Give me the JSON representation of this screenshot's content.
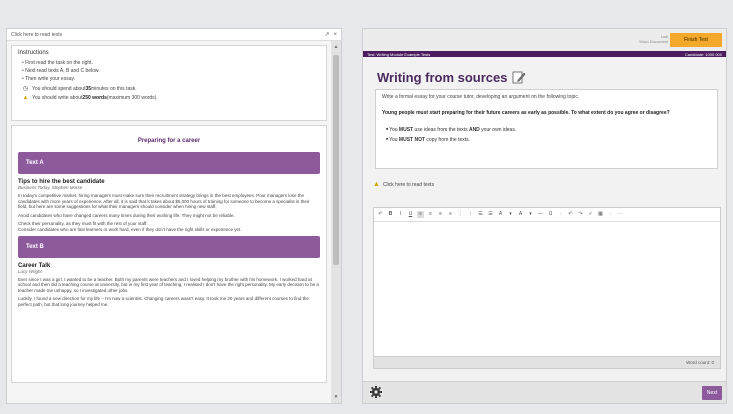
{
  "left_pane": {
    "bar_label": "Click here to read texts",
    "controls": {
      "expand": "↗",
      "close": "×"
    },
    "instructions": {
      "title": "Instructions",
      "items": [
        "First read the task on the right.",
        "Next read texts A, B and C below.",
        "Then write your essay."
      ],
      "time_note_pre": "You should spend about ",
      "time_note_bold": "35",
      "time_note_post": " minutes on this task.",
      "words_note_pre": "You should write about ",
      "words_note_bold": "250 words",
      "words_note_post": " (maximum 300 words)."
    },
    "document": {
      "title": "Preparing for a career",
      "text_a": {
        "heading": "Text A",
        "article_title": "Tips to hire the best candidate",
        "source": "Business Today, Stephen Morse",
        "paragraphs": [
          "In today's competitive market, hiring managers must make sure their recruitment strategy brings in the best employees. Poor managers lose the candidates with more years of experience. After all, it is said that it takes about $5,000 hours of training for someone to become a specialist in their field, but here are some suggestions for what their managers should consider when hiring new staff.",
          "Avoid candidates who have changed careers many times during their working life. They might not be reliable.",
          "Check their personality, as they must fit with the rest of your staff.",
          "Consider candidates who are fast learners or work hard, even if they don't have the right skills or experience yet."
        ]
      },
      "text_b": {
        "heading": "Text B",
        "article_title": "Career Talk",
        "source": "Lucy Wright",
        "paragraphs": [
          "Ever since I was a girl, I wanted to be a teacher. Both my parents were teachers and I loved helping my brother with his homework. I worked hard at school and then did a teaching course at university, but in my first year of teaching, I realised I don't have the right personality. My early decision to be a teacher made me unhappy, so I investigated other jobs.",
          "Luckily, I found a new direction for my life – I'm now a scientist. Changing careers wasn't easy. It took me 20 years and different courses to find the perfect path, but that long journey helped me."
        ]
      }
    }
  },
  "right_pane": {
    "top_info_line1": "Listi",
    "top_info_line2": "Word Document",
    "finish_button": "Finish Test",
    "task_bar_left": "Test: Writing Module Example Tests",
    "task_bar_right": "Candidate: 1000 000",
    "writing_title": "Writing from sources",
    "task": {
      "line1": "Write a formal essay for your course tutor, developing an argument on the following topic.",
      "question": "Young people must start preparing for their future careers as early as possible. To what extent do you agree or disagree?",
      "bullet1_pre": "You ",
      "bullet1_bold": "MUST",
      "bullet1_mid": " use ideas from the texts ",
      "bullet1_bold2": "AND",
      "bullet1_post": " your own ideas.",
      "bullet2_pre": "You ",
      "bullet2_bold": "MUST NOT",
      "bullet2_post": " copy from the texts."
    },
    "click_tools_text": "Click here to read texts",
    "editor": {
      "toolbar": [
        "↶",
        "B",
        "I",
        "U",
        "≡",
        "≡",
        "≡",
        "≡",
        "⋮",
        "⁝",
        "☰",
        "☰",
        "A",
        "▾",
        "A",
        "▾",
        "—",
        "Ω",
        "·",
        "↶",
        "↷",
        "✓",
        "▦",
        "·",
        "⋯"
      ],
      "word_count": "Word count: 0"
    },
    "next_button": "Next"
  },
  "icons": {
    "warn": "warning-icon",
    "clock": "clock-icon",
    "pencil": "pencil-icon",
    "settings": "gear-icon"
  },
  "colors": {
    "purple_dark": "#4c1d5e",
    "purple_header": "#8d5a9c",
    "finish_orange": "#f4a92a"
  }
}
